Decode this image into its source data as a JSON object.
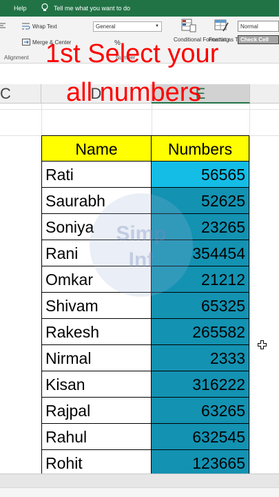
{
  "ribbon": {
    "tabs": {
      "help": "Help",
      "tell_me": "Tell me what you want to do"
    },
    "wrap_text": "Wrap Text",
    "merge_center": "Merge & Center",
    "number_format": "General",
    "percent_symbol": "%",
    "conditional_formatting": "Conditional Formatting",
    "format_as_table": "Format as Table",
    "style_normal": "Normal",
    "style_check_cell": "Check Cell",
    "group_alignment": "Alignment",
    "group_number": "Number"
  },
  "column_headers": {
    "c": "C",
    "d": "D",
    "e": "E"
  },
  "overlay": {
    "line1": "1st Select your",
    "line2": "all numbers"
  },
  "watermark": {
    "line1": "Simp",
    "line2": "Inf"
  },
  "table": {
    "headers": {
      "name": "Name",
      "numbers": "Numbers"
    },
    "rows": [
      {
        "name": "Rati",
        "number": "56565"
      },
      {
        "name": "Saurabh",
        "number": "52625"
      },
      {
        "name": "Soniya",
        "number": "23265"
      },
      {
        "name": "Rani",
        "number": "354454"
      },
      {
        "name": "Omkar",
        "number": "21212"
      },
      {
        "name": "Shivam",
        "number": "65325"
      },
      {
        "name": "Rakesh",
        "number": "265582"
      },
      {
        "name": "Nirmal",
        "number": "2333"
      },
      {
        "name": "Kisan",
        "number": "316222"
      },
      {
        "name": "Rajpal",
        "number": "63265"
      },
      {
        "name": "Rahul",
        "number": "632545"
      },
      {
        "name": "Rohit",
        "number": "123665"
      }
    ]
  },
  "colors": {
    "ribbon_green": "#217346",
    "header_yellow": "#ffff00",
    "selection_blue": "#1392b2",
    "active_cell_blue": "#14bde6",
    "overlay_red": "#ff0000"
  },
  "icons": [
    "lightbulb-icon",
    "wrap-text-icon",
    "merge-center-icon",
    "conditional-formatting-icon",
    "format-as-table-icon",
    "plus-cursor-icon"
  ]
}
